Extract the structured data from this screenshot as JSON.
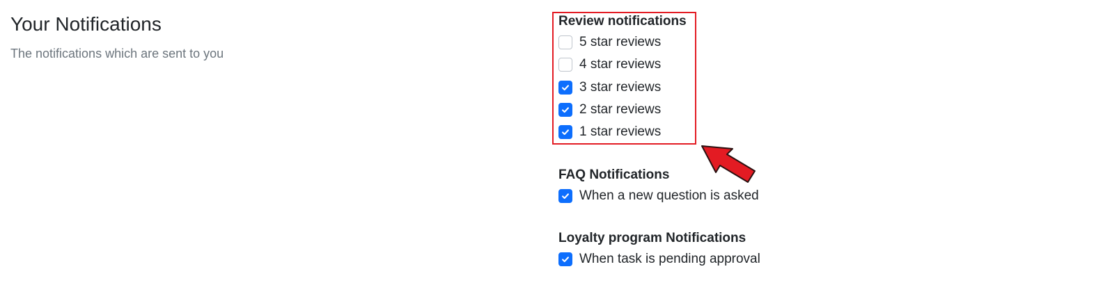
{
  "intro": {
    "title": "Your Notifications",
    "subtitle": "The notifications which are sent to you"
  },
  "review": {
    "title": "Review notifications",
    "items": [
      {
        "label": "5 star reviews",
        "checked": false
      },
      {
        "label": "4 star reviews",
        "checked": false
      },
      {
        "label": "3 star reviews",
        "checked": true
      },
      {
        "label": "2 star reviews",
        "checked": true
      },
      {
        "label": "1 star reviews",
        "checked": true
      }
    ]
  },
  "faq": {
    "title": "FAQ Notifications",
    "items": [
      {
        "label": "When a new question is asked",
        "checked": true
      }
    ]
  },
  "loyalty": {
    "title": "Loyalty program Notifications",
    "items": [
      {
        "label": "When task is pending approval",
        "checked": true
      }
    ]
  },
  "colors": {
    "checkbox_checked": "#0d6efd",
    "highlight": "#e31b23",
    "arrow": "#e31b23"
  }
}
